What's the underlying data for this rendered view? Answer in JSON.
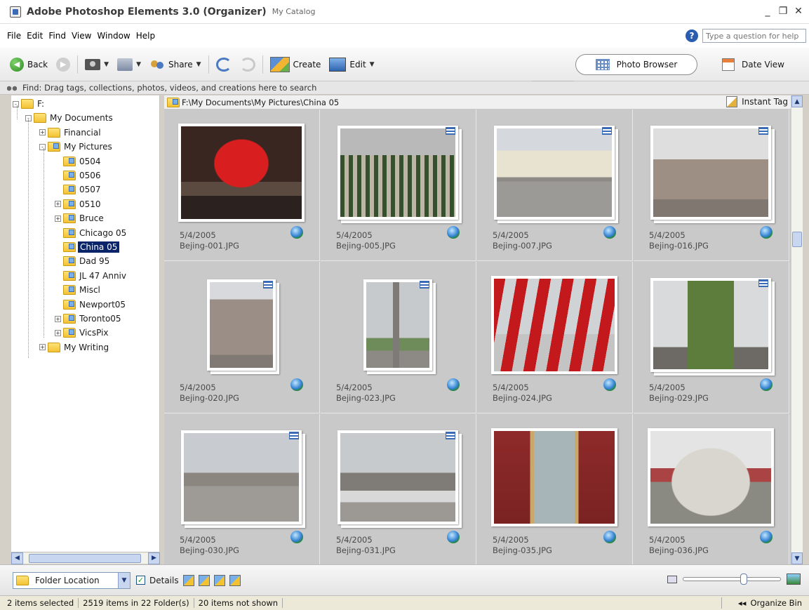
{
  "window": {
    "title": "Adobe Photoshop Elements 3.0 (Organizer)",
    "subtitle": "My Catalog",
    "controls": [
      "_",
      "❐",
      "✕"
    ]
  },
  "menu": {
    "items": [
      {
        "label": "File"
      },
      {
        "label": "Edit"
      },
      {
        "label": "Find"
      },
      {
        "label": "View"
      },
      {
        "label": "Window"
      },
      {
        "label": "Help"
      }
    ],
    "help_placeholder": "Type a question for help"
  },
  "toolbar": {
    "back_label": "Back",
    "share_label": "Share",
    "create_label": "Create",
    "edit_label": "Edit",
    "photo_browser_label": "Photo Browser",
    "date_view_label": "Date View"
  },
  "findbar": {
    "text": "Find: Drag tags, collections, photos, videos, and creations here to search"
  },
  "tree": {
    "items": [
      {
        "label": "F:",
        "level": 0,
        "expander": "-",
        "icon": "folder"
      },
      {
        "label": "My Documents",
        "level": 1,
        "expander": "-",
        "icon": "folder"
      },
      {
        "label": "Financial",
        "level": 2,
        "expander": "+",
        "icon": "folder"
      },
      {
        "label": "My Pictures",
        "level": 2,
        "expander": "-",
        "icon": "folder-pic"
      },
      {
        "label": "0504",
        "level": 3,
        "expander": "",
        "icon": "folder-pic"
      },
      {
        "label": "0506",
        "level": 3,
        "expander": "",
        "icon": "folder-pic"
      },
      {
        "label": "0507",
        "level": 3,
        "expander": "",
        "icon": "folder-pic"
      },
      {
        "label": "0510",
        "level": 3,
        "expander": "+",
        "icon": "folder-pic"
      },
      {
        "label": "Bruce",
        "level": 3,
        "expander": "+",
        "icon": "folder-pic"
      },
      {
        "label": "Chicago 05",
        "level": 3,
        "expander": "",
        "icon": "folder-pic"
      },
      {
        "label": "China 05",
        "level": 3,
        "expander": "",
        "icon": "folder-pic",
        "selected": true
      },
      {
        "label": "Dad 95",
        "level": 3,
        "expander": "",
        "icon": "folder-pic"
      },
      {
        "label": "JL 47 Anniv",
        "level": 3,
        "expander": "",
        "icon": "folder-pic"
      },
      {
        "label": "Miscl",
        "level": 3,
        "expander": "",
        "icon": "folder-pic"
      },
      {
        "label": "Newport05",
        "level": 3,
        "expander": "",
        "icon": "folder-pic"
      },
      {
        "label": "Toronto05",
        "level": 3,
        "expander": "+",
        "icon": "folder-pic"
      },
      {
        "label": "VicsPix",
        "level": 3,
        "expander": "+",
        "icon": "folder-pic"
      },
      {
        "label": "My Writing",
        "level": 2,
        "expander": "+",
        "icon": "folder"
      }
    ]
  },
  "browser": {
    "path": "F:\\My Documents\\My Pictures\\China 05",
    "instant_tag_label": "Instant Tag",
    "photos": [
      {
        "date": "5/4/2005",
        "name": "Bejing-001.JPG",
        "stacked": false,
        "scene": "lantern"
      },
      {
        "date": "5/4/2005",
        "name": "Bejing-005.JPG",
        "stacked": true,
        "scene": "soldiers"
      },
      {
        "date": "5/4/2005",
        "name": "Bejing-007.JPG",
        "stacked": true,
        "scene": "hall"
      },
      {
        "date": "5/4/2005",
        "name": "Bejing-016.JPG",
        "stacked": true,
        "scene": "sculpture"
      },
      {
        "date": "5/4/2005",
        "name": "Bejing-020.JPG",
        "stacked": true,
        "scene": "statue-portrait"
      },
      {
        "date": "5/4/2005",
        "name": "Bejing-023.JPG",
        "stacked": true,
        "scene": "monument"
      },
      {
        "date": "5/4/2005",
        "name": "Bejing-024.JPG",
        "stacked": false,
        "scene": "flags"
      },
      {
        "date": "5/4/2005",
        "name": "Bejing-029.JPG",
        "stacked": true,
        "scene": "portrait-sun"
      },
      {
        "date": "5/4/2005",
        "name": "Bejing-030.JPG",
        "stacked": true,
        "scene": "square"
      },
      {
        "date": "5/4/2005",
        "name": "Bejing-031.JPG",
        "stacked": true,
        "scene": "square-man"
      },
      {
        "date": "5/4/2005",
        "name": "Bejing-035.JPG",
        "stacked": false,
        "scene": "portrait-mao"
      },
      {
        "date": "5/4/2005",
        "name": "Bejing-036.JPG",
        "stacked": false,
        "scene": "lion"
      }
    ]
  },
  "bottom": {
    "folder_location_label": "Folder Location",
    "details_label": "Details",
    "details_checked": "✓",
    "zoom_level": 0.62
  },
  "status": {
    "selected": "2 items selected",
    "items": "2519 items in 22 Folder(s)",
    "hidden": "20 items not shown",
    "organize_bin_label": "Organize Bin",
    "organize_bin_arrow": "◂◂"
  },
  "colors": {
    "selection": "#0a246a",
    "accent": "#3c6bb5",
    "grid_bg": "#c9c9c9"
  }
}
